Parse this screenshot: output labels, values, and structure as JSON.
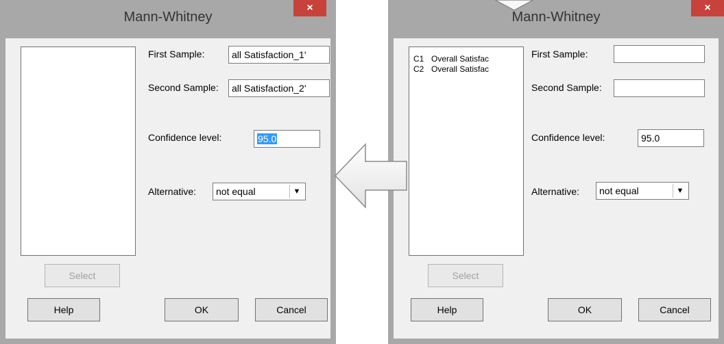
{
  "left_dialog": {
    "title": "Mann-Whitney",
    "close_label": "×",
    "first_sample_label": "First Sample:",
    "first_sample_value": "all Satisfaction_1'",
    "second_sample_label": "Second Sample:",
    "second_sample_value": "all Satisfaction_2'",
    "confidence_label": "Confidence level:",
    "confidence_value": "95.0",
    "alternative_label": "Alternative:",
    "alternative_value": "not equal",
    "select_label": "Select",
    "help_label": "Help",
    "ok_label": "OK",
    "cancel_label": "Cancel"
  },
  "right_dialog": {
    "title": "Mann-Whitney",
    "close_label": "×",
    "columns": [
      {
        "code": "C1",
        "name": "Overall Satisfac"
      },
      {
        "code": "C2",
        "name": "Overall Satisfac"
      }
    ],
    "first_sample_label": "First Sample:",
    "first_sample_value": "",
    "second_sample_label": "Second Sample:",
    "second_sample_value": "",
    "confidence_label": "Confidence level:",
    "confidence_value": "95.0",
    "alternative_label": "Alternative:",
    "alternative_value": "not equal",
    "select_label": "Select",
    "help_label": "Help",
    "ok_label": "OK",
    "cancel_label": "Cancel"
  },
  "icons": {
    "left_arrow": "arrow-left-icon",
    "down_arrow": "arrow-down-icon"
  },
  "colors": {
    "close_button": "#c7423a",
    "selection": "#3399ff",
    "frame": "#a8a8a8"
  }
}
